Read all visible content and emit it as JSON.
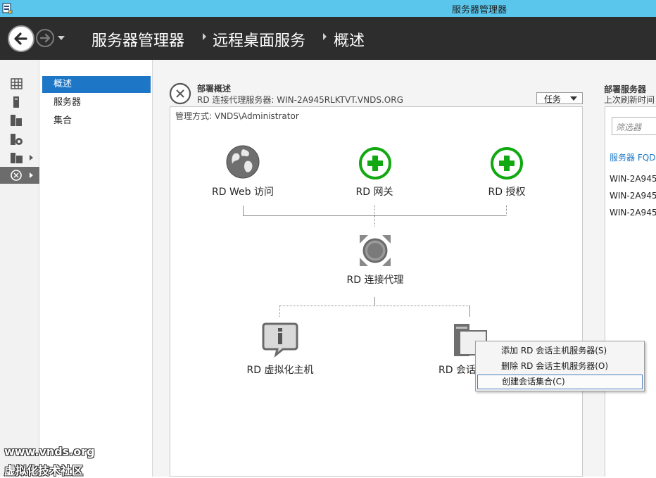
{
  "window": {
    "title": "服务器管理器"
  },
  "header": {
    "breadcrumbs": [
      "服务器管理器",
      "远程桌面服务",
      "概述"
    ]
  },
  "nav": {
    "items": [
      {
        "label": "概述",
        "active": true
      },
      {
        "label": "服务器",
        "active": false
      },
      {
        "label": "集合",
        "active": false
      }
    ]
  },
  "deployment": {
    "heading": "部署概述",
    "subheading": "RD 连接代理服务器: WIN-2A945RLKTVT.VNDS.ORG",
    "tasks_label": "任务",
    "managed_by": "管理方式: VNDS\\Administrator",
    "nodes": {
      "web_access": "RD Web 访问",
      "gateway": "RD 网关",
      "licensing": "RD 授权",
      "broker": "RD 连接代理",
      "virtualization_host": "RD 虚拟化主机",
      "session_host": "RD 会话"
    }
  },
  "servers_panel": {
    "heading": "部署服务器",
    "refresh": "上次刷新时间",
    "filter_placeholder": "筛选器",
    "column": "服务器 FQD",
    "rows": [
      "WIN-2A945",
      "WIN-2A945",
      "WIN-2A945"
    ]
  },
  "context_menu": {
    "items": [
      "添加 RD 会话主机服务器(S)",
      "删除 RD 会话主机服务器(O)",
      "创建会话集合(C)"
    ]
  },
  "watermark": {
    "line1": "www.vnds.org",
    "line2": "虚拟化技术社区"
  },
  "colors": {
    "titlebar": "#5bc6ec",
    "header": "#2d2d2d",
    "accent": "#1d77c6",
    "green": "#11a811"
  }
}
